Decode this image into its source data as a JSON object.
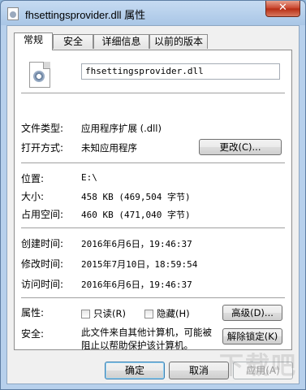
{
  "window": {
    "title": "fhsettingsprovider.dll 属性",
    "close_glyph": "✕"
  },
  "tabs": [
    {
      "label": "常规",
      "active": true
    },
    {
      "label": "安全",
      "active": false
    },
    {
      "label": "详细信息",
      "active": false
    },
    {
      "label": "以前的版本",
      "active": false
    }
  ],
  "general": {
    "file_name": "fhsettingsprovider.dll",
    "file_type_label": "文件类型:",
    "file_type_value": "应用程序扩展 (.dll)",
    "opens_with_label": "打开方式:",
    "opens_with_value": "未知应用程序",
    "change_button": "更改(C)...",
    "location_label": "位置:",
    "location_value": "E:\\",
    "size_label": "大小:",
    "size_value": "458 KB (469,504 字节)",
    "size_on_disk_label": "占用空间:",
    "size_on_disk_value": "460 KB (471,040 字节)",
    "created_label": "创建时间:",
    "created_value": "2016年6月6日，19:46:37",
    "modified_label": "修改时间:",
    "modified_value": "2015年7月10日，18:59:54",
    "accessed_label": "访问时间:",
    "accessed_value": "2016年6月6日，19:46:37",
    "attributes_label": "属性:",
    "readonly_label": "只读(R)",
    "hidden_label": "隐藏(H)",
    "advanced_button": "高级(D)...",
    "security_label": "安全:",
    "security_text": "此文件来自其他计算机，可能被阻止以帮助保护该计算机。",
    "unblock_button": "解除锁定(K)"
  },
  "footer": {
    "ok": "确定",
    "cancel": "取消",
    "apply": "应用(A)"
  },
  "watermark": "下载吧"
}
